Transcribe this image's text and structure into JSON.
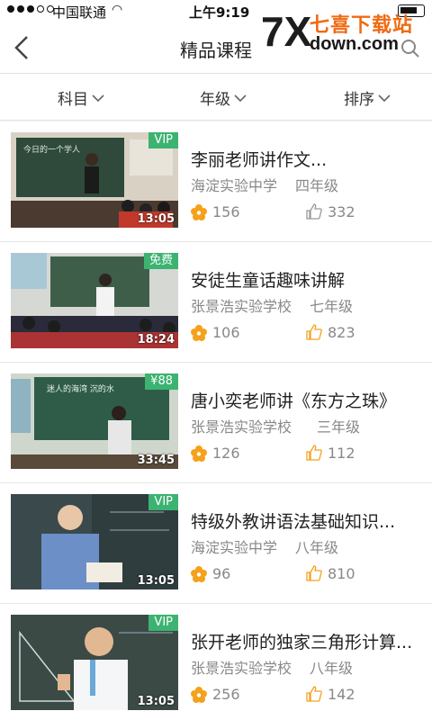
{
  "status_bar": {
    "carrier": "中国联通",
    "time": "上午9:19"
  },
  "nav": {
    "title": "精品课程"
  },
  "watermark": {
    "brand": "七喜下载站",
    "url": "down.com"
  },
  "filters": [
    {
      "label": "科目"
    },
    {
      "label": "年级"
    },
    {
      "label": "排序"
    }
  ],
  "courses": [
    {
      "title": "李丽老师讲作文...",
      "school": "海淀实验中学",
      "grade": "四年级",
      "views": "156",
      "likes": "332",
      "badge": "VIP",
      "duration": "13:05",
      "board_color": "#2f4a3a",
      "board_text": "今日的一个学人"
    },
    {
      "title": "安徒生童话趣味讲解",
      "school": "张景浩实验学校",
      "grade": "七年级",
      "views": "106",
      "likes": "823",
      "badge": "免费",
      "duration": "18:24",
      "board_color": "#3f5e4a",
      "board_text": ""
    },
    {
      "title": "唐小奕老师讲《东方之珠》",
      "school": "张景浩实验学校",
      "grade": "三年级",
      "views": "126",
      "likes": "112",
      "badge": "¥88",
      "duration": "33:45",
      "board_color": "#2e5c49",
      "board_text": "迷人的海湾 沉的水"
    },
    {
      "title": "特级外教讲语法基础知识...",
      "school": "海淀实验中学",
      "grade": "八年级",
      "views": "96",
      "likes": "810",
      "badge": "VIP",
      "duration": "13:05",
      "board_color": "#3a4a4c",
      "board_text": ""
    },
    {
      "title": "张开老师的独家三角形计算...",
      "school": "张景浩实验学校",
      "grade": "八年级",
      "views": "256",
      "likes": "142",
      "badge": "VIP",
      "duration": "13:05",
      "board_color": "#3c4a45",
      "board_text": ""
    }
  ],
  "colors": {
    "accent": "#f5a11c",
    "badge_green": "#3cb371",
    "watermark_orange": "#f06a12"
  },
  "icons": {
    "back": "chevron-left-icon",
    "search": "search-icon",
    "filter": "chevron-down-icon",
    "views": "flower-icon",
    "likes": "thumbs-up-icon"
  }
}
